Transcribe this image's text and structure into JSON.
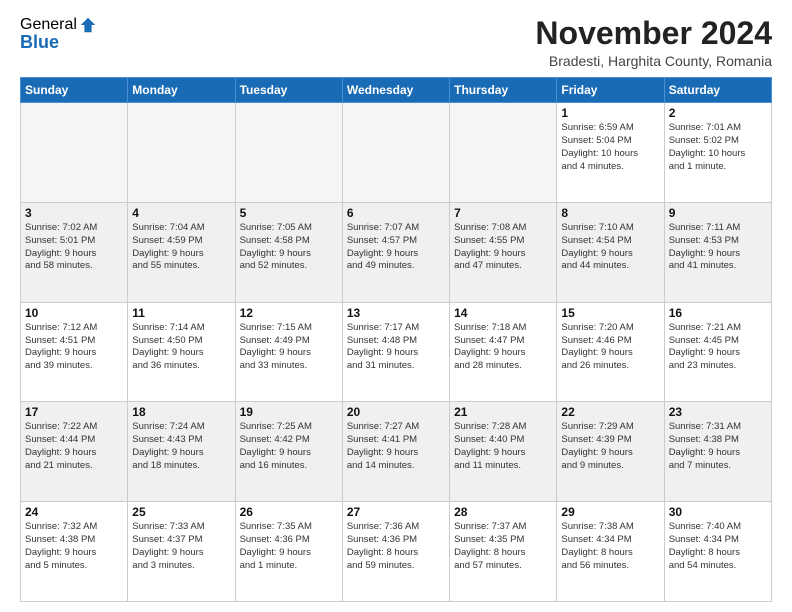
{
  "logo": {
    "general": "General",
    "blue": "Blue"
  },
  "title": "November 2024",
  "location": "Bradesti, Harghita County, Romania",
  "days_header": [
    "Sunday",
    "Monday",
    "Tuesday",
    "Wednesday",
    "Thursday",
    "Friday",
    "Saturday"
  ],
  "weeks": [
    [
      {
        "day": "",
        "info": ""
      },
      {
        "day": "",
        "info": ""
      },
      {
        "day": "",
        "info": ""
      },
      {
        "day": "",
        "info": ""
      },
      {
        "day": "",
        "info": ""
      },
      {
        "day": "1",
        "info": "Sunrise: 6:59 AM\nSunset: 5:04 PM\nDaylight: 10 hours\nand 4 minutes."
      },
      {
        "day": "2",
        "info": "Sunrise: 7:01 AM\nSunset: 5:02 PM\nDaylight: 10 hours\nand 1 minute."
      }
    ],
    [
      {
        "day": "3",
        "info": "Sunrise: 7:02 AM\nSunset: 5:01 PM\nDaylight: 9 hours\nand 58 minutes."
      },
      {
        "day": "4",
        "info": "Sunrise: 7:04 AM\nSunset: 4:59 PM\nDaylight: 9 hours\nand 55 minutes."
      },
      {
        "day": "5",
        "info": "Sunrise: 7:05 AM\nSunset: 4:58 PM\nDaylight: 9 hours\nand 52 minutes."
      },
      {
        "day": "6",
        "info": "Sunrise: 7:07 AM\nSunset: 4:57 PM\nDaylight: 9 hours\nand 49 minutes."
      },
      {
        "day": "7",
        "info": "Sunrise: 7:08 AM\nSunset: 4:55 PM\nDaylight: 9 hours\nand 47 minutes."
      },
      {
        "day": "8",
        "info": "Sunrise: 7:10 AM\nSunset: 4:54 PM\nDaylight: 9 hours\nand 44 minutes."
      },
      {
        "day": "9",
        "info": "Sunrise: 7:11 AM\nSunset: 4:53 PM\nDaylight: 9 hours\nand 41 minutes."
      }
    ],
    [
      {
        "day": "10",
        "info": "Sunrise: 7:12 AM\nSunset: 4:51 PM\nDaylight: 9 hours\nand 39 minutes."
      },
      {
        "day": "11",
        "info": "Sunrise: 7:14 AM\nSunset: 4:50 PM\nDaylight: 9 hours\nand 36 minutes."
      },
      {
        "day": "12",
        "info": "Sunrise: 7:15 AM\nSunset: 4:49 PM\nDaylight: 9 hours\nand 33 minutes."
      },
      {
        "day": "13",
        "info": "Sunrise: 7:17 AM\nSunset: 4:48 PM\nDaylight: 9 hours\nand 31 minutes."
      },
      {
        "day": "14",
        "info": "Sunrise: 7:18 AM\nSunset: 4:47 PM\nDaylight: 9 hours\nand 28 minutes."
      },
      {
        "day": "15",
        "info": "Sunrise: 7:20 AM\nSunset: 4:46 PM\nDaylight: 9 hours\nand 26 minutes."
      },
      {
        "day": "16",
        "info": "Sunrise: 7:21 AM\nSunset: 4:45 PM\nDaylight: 9 hours\nand 23 minutes."
      }
    ],
    [
      {
        "day": "17",
        "info": "Sunrise: 7:22 AM\nSunset: 4:44 PM\nDaylight: 9 hours\nand 21 minutes."
      },
      {
        "day": "18",
        "info": "Sunrise: 7:24 AM\nSunset: 4:43 PM\nDaylight: 9 hours\nand 18 minutes."
      },
      {
        "day": "19",
        "info": "Sunrise: 7:25 AM\nSunset: 4:42 PM\nDaylight: 9 hours\nand 16 minutes."
      },
      {
        "day": "20",
        "info": "Sunrise: 7:27 AM\nSunset: 4:41 PM\nDaylight: 9 hours\nand 14 minutes."
      },
      {
        "day": "21",
        "info": "Sunrise: 7:28 AM\nSunset: 4:40 PM\nDaylight: 9 hours\nand 11 minutes."
      },
      {
        "day": "22",
        "info": "Sunrise: 7:29 AM\nSunset: 4:39 PM\nDaylight: 9 hours\nand 9 minutes."
      },
      {
        "day": "23",
        "info": "Sunrise: 7:31 AM\nSunset: 4:38 PM\nDaylight: 9 hours\nand 7 minutes."
      }
    ],
    [
      {
        "day": "24",
        "info": "Sunrise: 7:32 AM\nSunset: 4:38 PM\nDaylight: 9 hours\nand 5 minutes."
      },
      {
        "day": "25",
        "info": "Sunrise: 7:33 AM\nSunset: 4:37 PM\nDaylight: 9 hours\nand 3 minutes."
      },
      {
        "day": "26",
        "info": "Sunrise: 7:35 AM\nSunset: 4:36 PM\nDaylight: 9 hours\nand 1 minute."
      },
      {
        "day": "27",
        "info": "Sunrise: 7:36 AM\nSunset: 4:36 PM\nDaylight: 8 hours\nand 59 minutes."
      },
      {
        "day": "28",
        "info": "Sunrise: 7:37 AM\nSunset: 4:35 PM\nDaylight: 8 hours\nand 57 minutes."
      },
      {
        "day": "29",
        "info": "Sunrise: 7:38 AM\nSunset: 4:34 PM\nDaylight: 8 hours\nand 56 minutes."
      },
      {
        "day": "30",
        "info": "Sunrise: 7:40 AM\nSunset: 4:34 PM\nDaylight: 8 hours\nand 54 minutes."
      }
    ]
  ]
}
